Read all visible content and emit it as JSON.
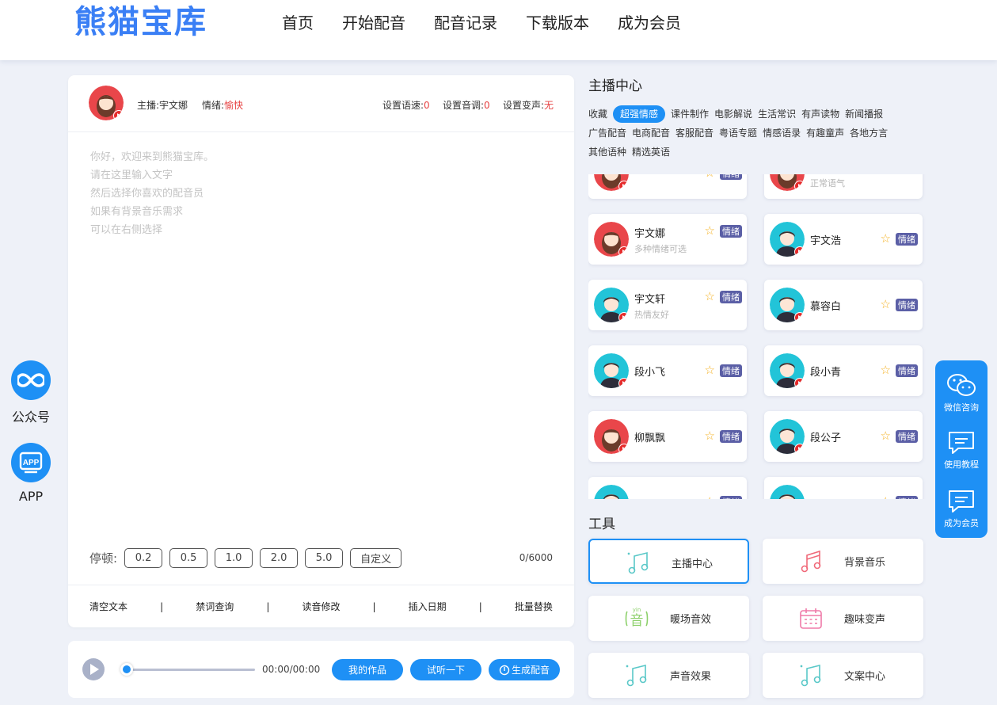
{
  "header": {
    "logo": "熊猫宝库",
    "nav": [
      "首页",
      "开始配音",
      "配音记录",
      "下载版本",
      "成为会员"
    ]
  },
  "left_sidebar": [
    {
      "label": "公众号",
      "icon": "infinity-icon"
    },
    {
      "label": "APP",
      "icon": "app-icon"
    }
  ],
  "editor": {
    "anchor_label": "主播:",
    "anchor_name": "宇文娜",
    "emotion_label": "情绪:",
    "emotion_value": "愉快",
    "speed_label": "设置语速:",
    "speed_value": "0",
    "pitch_label": "设置音调:",
    "pitch_value": "0",
    "voice_label": "设置变声:",
    "voice_value": "无",
    "placeholder": "你好，欢迎来到熊猫宝库。\n请在这里输入文字\n然后选择你喜欢的配音员\n如果有背景音乐需求\n可以在右侧选择",
    "pause_label": "停顿:",
    "pause_options": [
      "0.2",
      "0.5",
      "1.0",
      "2.0",
      "5.0",
      "自定义"
    ],
    "char_count": "0/6000",
    "tools": [
      "清空文本",
      "|",
      "禁词查询",
      "|",
      "读音修改",
      "|",
      "插入日期",
      "|",
      "批量替换"
    ]
  },
  "player": {
    "time": "00:00/00:00",
    "my_works": "我的作品",
    "preview": "试听一下",
    "generate": "生成配音"
  },
  "anchor_center": {
    "title": "主播中心",
    "categories": [
      "收藏",
      "超强情感",
      "课件制作",
      "电影解说",
      "生活常识",
      "有声读物",
      "新闻播报",
      "广告配音",
      "电商配音",
      "客服配音",
      "粤语专题",
      "情感语录",
      "有趣童声",
      "各地方言",
      "其他语种",
      "精选英语"
    ],
    "active_category": "超强情感",
    "anchors": [
      {
        "name": "",
        "desc": "",
        "tag": "情绪",
        "gender": "f"
      },
      {
        "name": "",
        "desc": "正常语气",
        "tag": "",
        "gender": "f"
      },
      {
        "name": "宇文娜",
        "desc": "多种情绪可选",
        "tag": "情绪",
        "gender": "f"
      },
      {
        "name": "宇文浩",
        "desc": "",
        "tag": "情绪",
        "gender": "m"
      },
      {
        "name": "宇文轩",
        "desc": "热情友好",
        "tag": "情绪",
        "gender": "m"
      },
      {
        "name": "慕容白",
        "desc": "",
        "tag": "情绪",
        "gender": "m"
      },
      {
        "name": "段小飞",
        "desc": "",
        "tag": "情绪",
        "gender": "m"
      },
      {
        "name": "段小青",
        "desc": "",
        "tag": "情绪",
        "gender": "m"
      },
      {
        "name": "柳飘飘",
        "desc": "",
        "tag": "情绪",
        "gender": "f"
      },
      {
        "name": "段公子",
        "desc": "",
        "tag": "情绪",
        "gender": "m"
      },
      {
        "name": "",
        "desc": "",
        "tag": "情绪",
        "gender": "m"
      },
      {
        "name": "",
        "desc": "",
        "tag": "情绪",
        "gender": "m"
      }
    ]
  },
  "tools_section": {
    "title": "工具",
    "items": [
      {
        "label": "主播中心",
        "icon": "music-note-icon",
        "selected": true
      },
      {
        "label": "背景音乐",
        "icon": "music-note-icon",
        "selected": false
      },
      {
        "label": "暖场音效",
        "icon": "yin-sound-icon",
        "selected": false
      },
      {
        "label": "趣味变声",
        "icon": "calendar-icon",
        "selected": false
      },
      {
        "label": "声音效果",
        "icon": "music-note-icon",
        "selected": false
      },
      {
        "label": "文案中心",
        "icon": "music-note-icon",
        "selected": false
      }
    ]
  },
  "right_float": [
    {
      "label": "微信咨询",
      "icon": "wechat-icon"
    },
    {
      "label": "使用教程",
      "icon": "message-icon"
    },
    {
      "label": "成为会员",
      "icon": "message-icon"
    }
  ],
  "colors": {
    "primary": "#1e90f5",
    "logo": "#3a7ff5",
    "accent_red": "#e64242",
    "tag": "#5b5fa6"
  }
}
